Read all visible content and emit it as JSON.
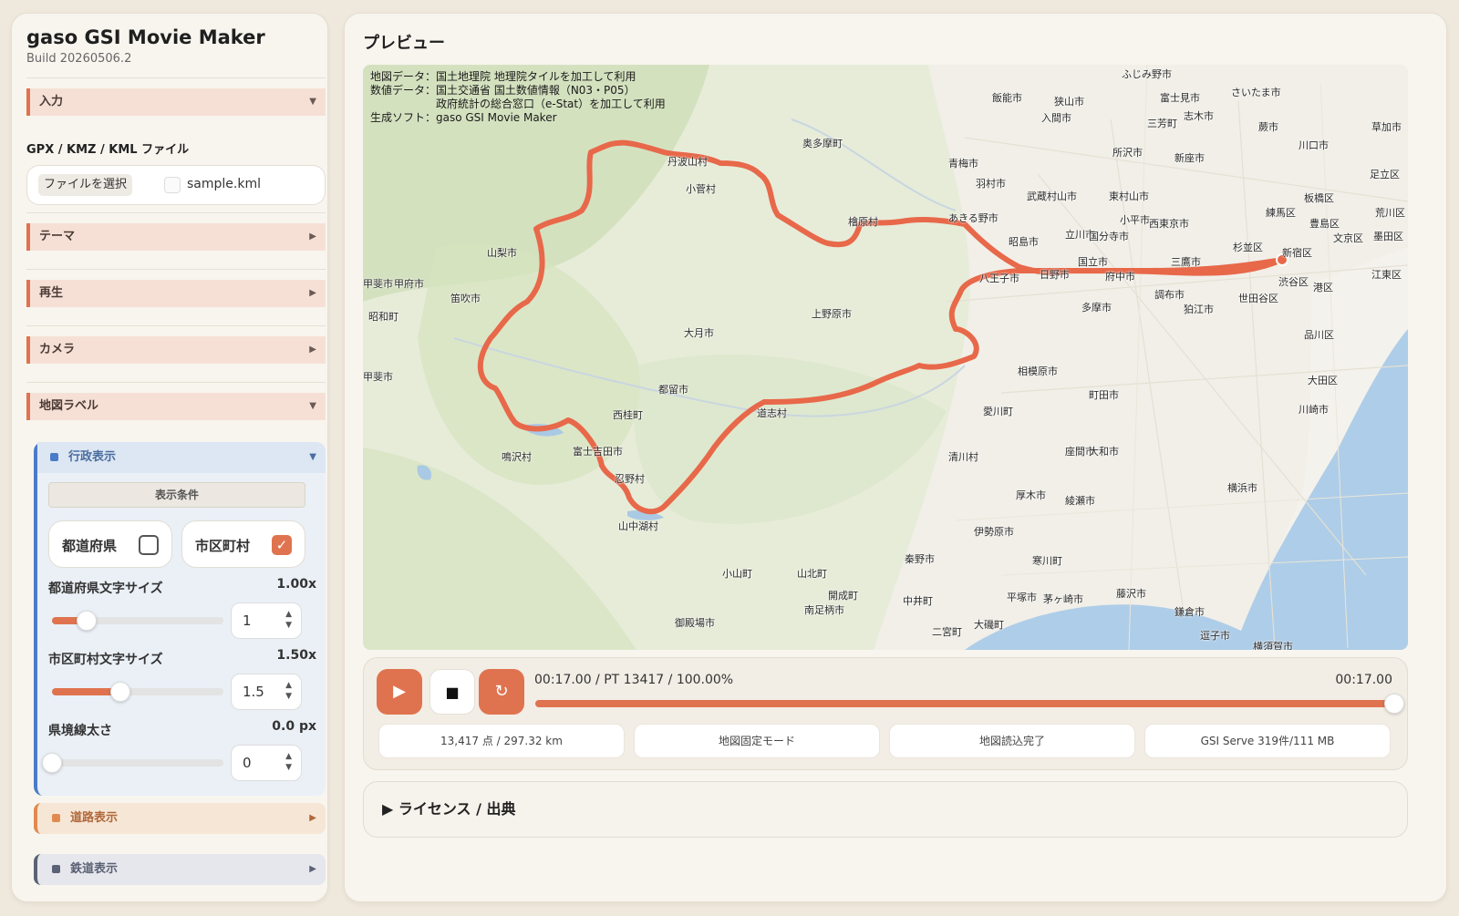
{
  "app": {
    "title": "gaso GSI Movie Maker",
    "build": "Build 20260506.2"
  },
  "sidebar": {
    "input_section": "入力",
    "file_label": "GPX / KMZ / KML ファイル",
    "file_button": "ファイルを選択",
    "file_name": "sample.kml",
    "theme_section": "テーマ",
    "playback_section": "再生",
    "camera_section": "カメラ",
    "map_label_section": "地図ラベル",
    "admin": {
      "title": "行政表示",
      "condition_button": "表示条件",
      "prefecture_label": "都道府県",
      "prefecture_checked": false,
      "municipality_label": "市区町村",
      "municipality_checked": true,
      "pref_font_label": "都道府県文字サイズ",
      "pref_font_value": "1.00x",
      "pref_font_input": "1",
      "pref_font_fraction": 0.2,
      "muni_font_label": "市区町村文字サイズ",
      "muni_font_value": "1.50x",
      "muni_font_input": "1.5",
      "muni_font_fraction": 0.4,
      "border_label": "県境線太さ",
      "border_value": "0.0 px",
      "border_input": "0",
      "border_fraction": 0.0
    },
    "road_section": "道路表示",
    "rail_section": "鉄道表示"
  },
  "preview": {
    "title": "プレビュー",
    "credits": [
      "地図データ：国土地理院 地理院タイルを加工して利用",
      "数値データ：国土交通省 国土数値情報（N03・P05）",
      "　　　　　　政府統計の総合窓口（e-Stat）を加工して利用",
      "生成ソフト：gaso GSI Movie Maker"
    ],
    "places": [
      "ふじみ野市",
      "さいたま市",
      "富士見市",
      "飯能市",
      "狭山市",
      "入間市",
      "志木市",
      "三芳町",
      "蕨市",
      "草加市",
      "奥多摩町",
      "所沢市",
      "川口市",
      "青梅市",
      "新座市",
      "足立区",
      "羽村市",
      "丹波山村",
      "小菅村",
      "武蔵村山市",
      "東村山市",
      "板橋区",
      "荒川区",
      "檜原村",
      "あきる野市",
      "小平市",
      "練馬区",
      "豊島区",
      "西東京市",
      "文京区",
      "墨田区",
      "山梨市",
      "昭島市",
      "立川市",
      "国分寺市",
      "杉並区",
      "新宿区",
      "甲府市",
      "甲斐市",
      "笛吹市",
      "八王子市",
      "日野市",
      "国立市",
      "府中市",
      "三鷹市",
      "江東区",
      "渋谷区",
      "港区",
      "昭和町",
      "上野原市",
      "多摩市",
      "調布市",
      "狛江市",
      "世田谷区",
      "大月市",
      "品川区",
      "甲斐市",
      "相模原市",
      "都留市",
      "町田市",
      "大田区",
      "西桂町",
      "愛川町",
      "川崎市",
      "富士吉田市",
      "鳴沢村",
      "清川村",
      "座間市",
      "大和市",
      "忍野村",
      "厚木市",
      "綾瀬市",
      "横浜市",
      "山中湖村",
      "伊勢原市",
      "秦野市",
      "寒川町",
      "小山町",
      "山北町",
      "開成町",
      "中井町",
      "平塚市",
      "茅ヶ崎市",
      "藤沢市",
      "南足柄市",
      "鎌倉市",
      "御殿場市",
      "二宮町",
      "大磯町",
      "逗子市",
      "横須賀市",
      "道志村"
    ],
    "time_text": "00:17.00 / PT 13417 / 100.00%",
    "time_end": "00:17.00",
    "progress": 1.0,
    "stats": [
      "13,417 点 / 297.32 km",
      "地図固定モード",
      "地図読込完了",
      "GSI Serve 319件/111 MB"
    ],
    "license": "▶ ライセンス / 出典"
  },
  "icons": {
    "play": "play-icon",
    "stop": "stop-icon",
    "loop": "loop-icon"
  },
  "colors": {
    "accent": "#e0734f",
    "route": "#e8684a",
    "admin": "#4a7bc8",
    "road": "#e08a4f",
    "rail": "#5b6275"
  }
}
